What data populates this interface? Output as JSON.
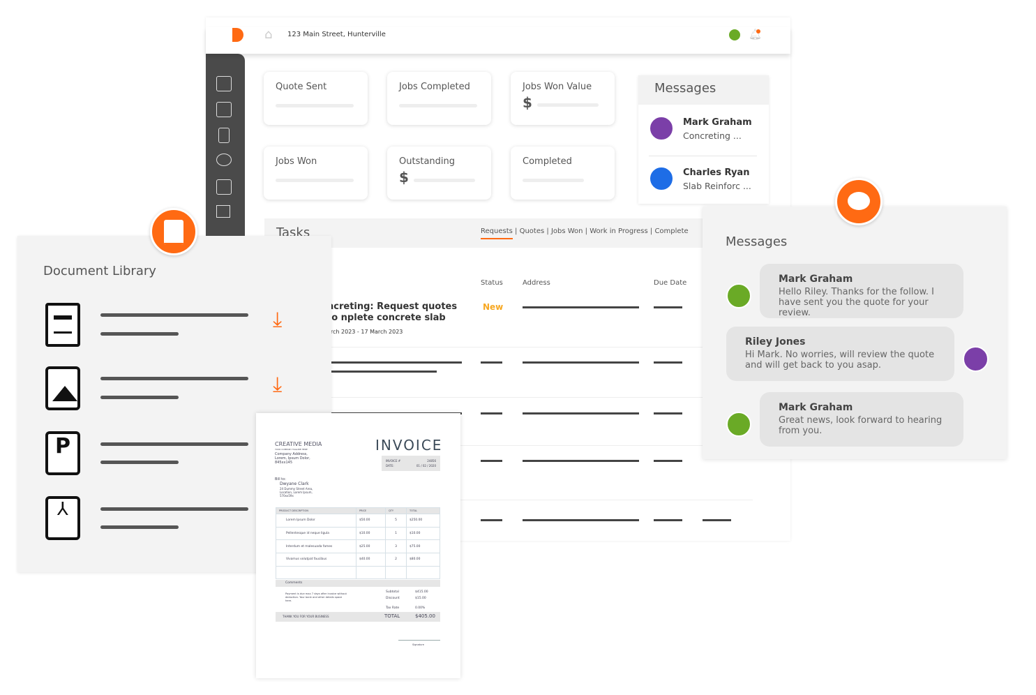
{
  "header": {
    "address": "123 Main Street, Hunterville",
    "logo": "B",
    "home_icon": "home-icon",
    "bell_icon": "bell-icon"
  },
  "colors": {
    "accent": "#ff6a13",
    "status_new": "#f7a823",
    "sidebar": "#4a4a4a"
  },
  "sidebar": {
    "icons": [
      "dashboard-icon",
      "search-document-icon",
      "document-icon",
      "chat-icon",
      "calendar-icon",
      "signpost-icon",
      "pen-icon"
    ]
  },
  "stats": [
    {
      "label": "Quote Sent"
    },
    {
      "label": "Jobs Completed"
    },
    {
      "label": "Jobs Won Value",
      "currency": "$"
    },
    {
      "label": "Jobs Won"
    },
    {
      "label": "Outstanding",
      "currency": "$"
    },
    {
      "label": "Completed"
    }
  ],
  "messages_panel": {
    "title": "Messages",
    "items": [
      {
        "name": "Mark Graham",
        "preview": "Concreting ..."
      },
      {
        "name": "Charles Ryan",
        "preview": "Slab Reinforc ..."
      }
    ]
  },
  "tasks": {
    "title": "Tasks",
    "tabs": [
      "Requests",
      "Quotes",
      "Jobs Won",
      "Work in Progress",
      "Complete"
    ],
    "active_tab": "Requests",
    "columns": [
      "Status",
      "Address",
      "Due Date"
    ],
    "rows": [
      {
        "title": "ncreting: Request quotes to nplete concrete slab",
        "dates": "arch 2023 - 17 March 2023",
        "status": "New"
      }
    ]
  },
  "document_library": {
    "title": "Document Library",
    "files": [
      {
        "type": "document-icon",
        "download": true
      },
      {
        "type": "image-file-icon",
        "download": true
      },
      {
        "type": "powerpoint-file-icon",
        "download": false
      },
      {
        "type": "pdf-file-icon",
        "download": false
      }
    ]
  },
  "invoice": {
    "company": "CREATIVE MEDIA",
    "tagline": "YOUR COMPANY TAGLINE HERE",
    "company_address": [
      "Company Address,",
      "Lorem, Ipsum Dolor,",
      "845xx145"
    ],
    "title": "INVOICE",
    "invoice_no_label": "INVOICE #",
    "invoice_no": "24856",
    "date_label": "DATE:",
    "date": "01 / 02 / 2020",
    "bill_to_label": "Bill to:",
    "bill_name": "Dwyane Clark",
    "bill_address": [
      "24 Dummy Street Area,",
      "Location, Lorem Ipsum,",
      "570xx59x"
    ],
    "columns": [
      "PRODUCT DESCRIPTION",
      "PRICE",
      "QTY",
      "TOTAL"
    ],
    "items": [
      {
        "desc": "Lorem Ipsum Dolor",
        "price": "$50.00",
        "qty": "5",
        "total": "$250.00"
      },
      {
        "desc": "Pellentesque id neque ligula",
        "price": "$10.00",
        "qty": "1",
        "total": "$10.00"
      },
      {
        "desc": "Interdum et malesuada fames",
        "price": "$25.00",
        "qty": "3",
        "total": "$75.00"
      },
      {
        "desc": "Vivamus volutpat faucibus",
        "price": "$40.00",
        "qty": "2",
        "total": "$80.00"
      }
    ],
    "comments_label": "Comments",
    "comments": "Payment is due max 7 days after invoice without deduction. Your bank and other details space here.",
    "subtotal_label": "Subtotal",
    "subtotal": "$415.00",
    "discount_label": "Discount",
    "discount": "$15.00",
    "tax_label": "Tax Rate",
    "tax": "0.00%",
    "thanks": "THANK YOU FOR YOUR BUSINESS",
    "total_label": "TOTAL",
    "total": "$405.00",
    "signature_label": "Signature"
  },
  "chat": {
    "title": "Messages",
    "messages": [
      {
        "name": "Mark Graham",
        "text": "Hello Riley. Thanks for the follow. I have sent you the quote for your review."
      },
      {
        "name": "Riley Jones",
        "text": "Hi Mark. No worries, will review the quote and will get back to you asap."
      },
      {
        "name": "Mark Graham",
        "text": "Great news, look forward to hearing from you."
      }
    ]
  }
}
